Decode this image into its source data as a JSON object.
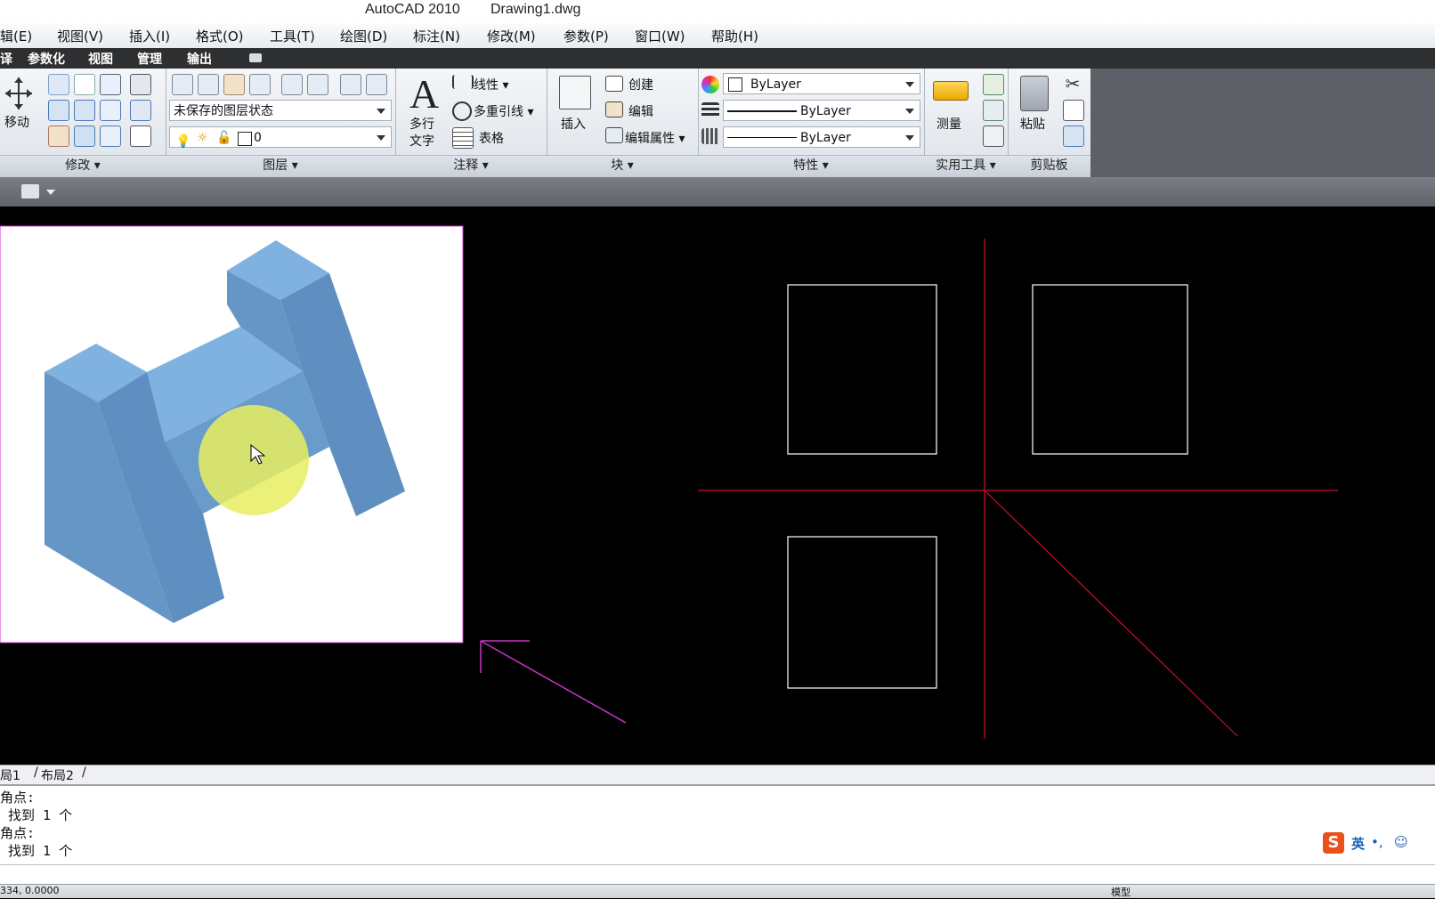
{
  "app": {
    "name": "AutoCAD 2010",
    "file": "Drawing1.dwg"
  },
  "menu": [
    "辑(E)",
    "视图(V)",
    "插入(I)",
    "格式(O)",
    "工具(T)",
    "绘图(D)",
    "标注(N)",
    "修改(M)",
    "参数(P)",
    "窗口(W)",
    "帮助(H)"
  ],
  "ribbon_tabs": [
    "译",
    "参数化",
    "视图",
    "管理",
    "输出"
  ],
  "panels": {
    "modify": {
      "title": "修改",
      "move": "移动"
    },
    "layers": {
      "title": "图层",
      "layer_state": "未保存的图层状态",
      "current_layer": "0"
    },
    "annotation": {
      "title": "注释",
      "mtext_line1": "多行",
      "mtext_line2": "文字",
      "linear": "线性",
      "multileader": "多重引线",
      "table": "表格"
    },
    "block": {
      "title": "块",
      "insert": "插入",
      "create": "创建",
      "edit": "编辑",
      "edit_attr": "编辑属性"
    },
    "properties": {
      "title": "特性",
      "color": "ByLayer",
      "lineweight": "ByLayer",
      "linetype": "ByLayer"
    },
    "utilities": {
      "title": "实用工具",
      "measure": "测量"
    },
    "clipboard": {
      "title": "剪贴板",
      "paste": "粘贴"
    }
  },
  "layout_tabs": [
    "局1",
    "布局2"
  ],
  "command_lines": [
    "角点:",
    " 找到 1 个",
    "角点:",
    " 找到 1 个"
  ],
  "status": {
    "coords": "334, 0.0000",
    "model": "模型"
  },
  "ime": {
    "label": "英"
  },
  "colors": {
    "accent_red": "#c8102e",
    "magenta": "#cc33cc",
    "shape_blue": "#6c9fd0",
    "highlight": "#e8ee60"
  }
}
